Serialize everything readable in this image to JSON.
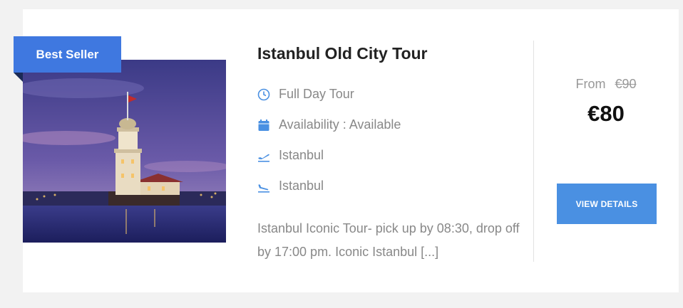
{
  "tour": {
    "badge": "Best Seller",
    "title": "Istanbul Old City Tour",
    "meta": {
      "duration": "Full Day Tour",
      "availability": "Availability : Available",
      "departure": "Istanbul",
      "arrival": "Istanbul"
    },
    "excerpt": " Istanbul Iconic Tour- pick up by 08:30, drop off by 17:00 pm. Iconic Istanbul [...]",
    "price": {
      "from_label": "From",
      "old": "€90",
      "current": "€80"
    },
    "button_label": "VIEW DETAILS"
  },
  "icons": {
    "duration": "clock-icon",
    "availability": "calendar-icon",
    "departure": "plane-takeoff-icon",
    "arrival": "plane-landing-icon"
  },
  "colors": {
    "accent": "#4a90e2",
    "badge": "#3f78e0",
    "text_muted": "#888888",
    "title": "#222222"
  }
}
